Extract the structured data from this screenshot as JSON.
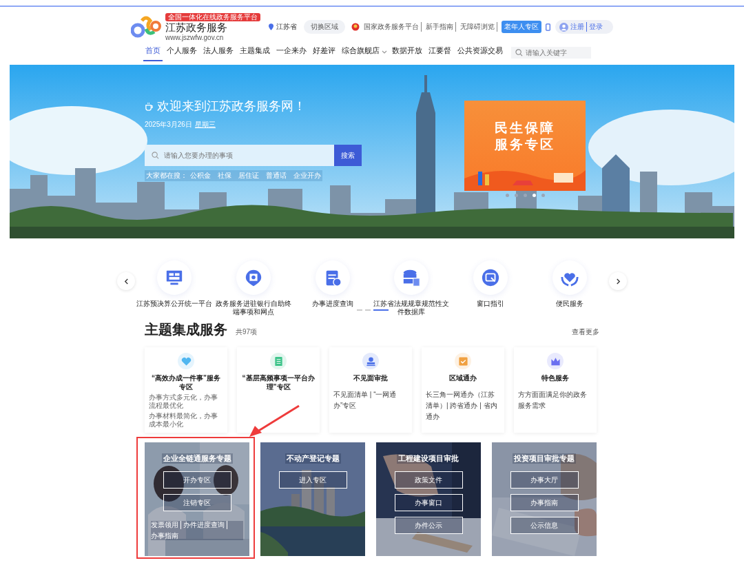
{
  "header": {
    "logo_badge": "全国一体化在线政务服务平台",
    "logo_title": "江苏政务服务",
    "logo_url": "www.jszwfw.gov.cn",
    "location": "江苏省",
    "region_switch": "切换区域",
    "top_links": [
      "国家政务服务平台",
      "新手指南",
      "无障碍浏览"
    ],
    "elder_button": "老年人专区",
    "auth_links": [
      "注册",
      "登录"
    ]
  },
  "nav": {
    "items": [
      {
        "label": "首页",
        "selected": true,
        "dropdown": false
      },
      {
        "label": "个人服务",
        "selected": false,
        "dropdown": false
      },
      {
        "label": "法人服务",
        "selected": false,
        "dropdown": false
      },
      {
        "label": "主题集成",
        "selected": false,
        "dropdown": false
      },
      {
        "label": "一企来办",
        "selected": false,
        "dropdown": false
      },
      {
        "label": "好差评",
        "selected": false,
        "dropdown": false
      },
      {
        "label": "综合旗舰店",
        "selected": false,
        "dropdown": true
      },
      {
        "label": "数据开放",
        "selected": false,
        "dropdown": false
      },
      {
        "label": "江要督",
        "selected": false,
        "dropdown": false
      },
      {
        "label": "公共资源交易",
        "selected": false,
        "dropdown": false
      }
    ],
    "search": {
      "placeholder": "请输入关键字"
    }
  },
  "banner": {
    "welcome": "欢迎来到江苏政务服务网！",
    "date": "2025年3月26日",
    "weekday": "星期三",
    "search": {
      "placeholder": "请输入您要办理的事项",
      "button": "搜索"
    },
    "hot_label": "大家都在搜：",
    "hot_terms": [
      "公积金",
      "社保",
      "居住证",
      "普通话",
      "企业开办"
    ],
    "promo": {
      "lines": [
        "民生保障",
        "服务专区"
      ]
    },
    "slides": [
      {
        "selected": false
      },
      {
        "selected": false
      },
      {
        "selected": false
      },
      {
        "selected": true
      },
      {
        "selected": false
      }
    ]
  },
  "quick_services": {
    "items": [
      {
        "label": "江苏预决算公开统一平台",
        "kind": "monitor"
      },
      {
        "label": "政务服务进驻银行自助终端事项和网点",
        "kind": "bank"
      },
      {
        "label": "办事进度查询",
        "kind": "calendar"
      },
      {
        "label": "江苏省法规规章规范性文件数据库",
        "kind": "database"
      },
      {
        "label": "窗口指引",
        "kind": "window"
      },
      {
        "label": "便民服务",
        "kind": "heart"
      }
    ],
    "pages": [
      {
        "selected": false
      },
      {
        "selected": false
      },
      {
        "selected": true
      }
    ]
  },
  "theme": {
    "title": "主题集成服务",
    "count": "共97项",
    "more": "查看更多",
    "cards": [
      {
        "title": "“高效办成一件事”服务专区",
        "notes": [
          "办事方式多元化，办事流程最优化",
          "办事材料最简化，办事成本最小化"
        ],
        "kind": "heart",
        "color": "#4fb6f0"
      },
      {
        "title": "“基层高频事项一平台办理”专区",
        "kind": "document",
        "color": "#3ec48a"
      },
      {
        "title": "不见面审批",
        "desc": "不见面清单 | “一网通办”专区",
        "kind": "stamp",
        "color": "#4a6fe8"
      },
      {
        "title": "区域通办",
        "desc": "长三角一网通办（江苏清单）| 跨省通办 | 省内通办",
        "kind": "check",
        "color": "#f0a040"
      },
      {
        "title": "特色服务",
        "desc": "方方面面满足你的政务服务需求",
        "kind": "crown",
        "color": "#6a6ff0"
      }
    ],
    "feature_cards": [
      {
        "title": "企业全链通服务专题",
        "buttons": [
          "开办专区",
          "注销专区"
        ],
        "links": [
          "发票领用",
          "办件进度查询",
          "办事指南"
        ],
        "highlighted": true
      },
      {
        "title": "不动产登记专题",
        "buttons": [
          "进入专区"
        ],
        "highlighted": false
      },
      {
        "title": "工程建设项目审批",
        "buttons": [
          "政策文件",
          "办事窗口",
          "办件公示"
        ],
        "highlighted": false
      },
      {
        "title": "投资项目审批专题",
        "buttons": [
          "办事大厅",
          "办事指南",
          "公示信息"
        ],
        "highlighted": false
      }
    ]
  }
}
